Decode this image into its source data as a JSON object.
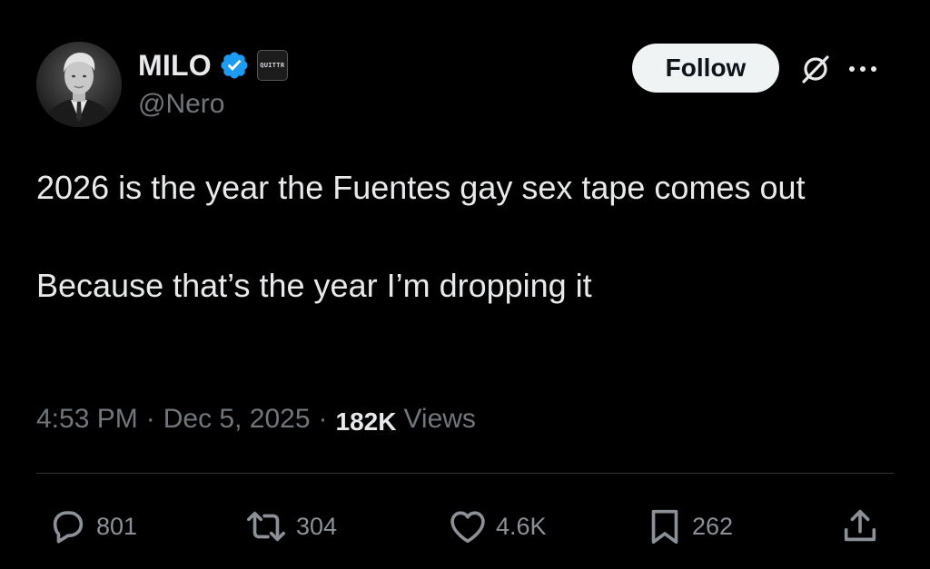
{
  "author": {
    "display_name": "MILO",
    "handle": "@Nero",
    "affiliate_badge_text": "QUITTR",
    "verified_color": "#1d9bf0"
  },
  "header": {
    "follow_label": "Follow",
    "grok_icon": "grok-icon",
    "more_icon": "more-dots-icon"
  },
  "tweet": {
    "text": "2026 is the year the Fuentes gay sex tape comes out\n\nBecause that’s the year I’m dropping it"
  },
  "meta": {
    "time": "4:53 PM",
    "separator": "·",
    "date": "Dec 5, 2025",
    "views_count": "182K",
    "views_label": "Views"
  },
  "actions": {
    "replies": "801",
    "reposts": "304",
    "likes": "4.6K",
    "bookmarks": "262",
    "icons": [
      "reply-icon",
      "repost-icon",
      "like-icon",
      "bookmark-icon",
      "share-icon"
    ]
  },
  "colors": {
    "background": "#000000",
    "primary_text": "#e7e9ea",
    "secondary_text": "#71767b",
    "divider": "#2f3336",
    "follow_bg": "#eff3f4"
  }
}
